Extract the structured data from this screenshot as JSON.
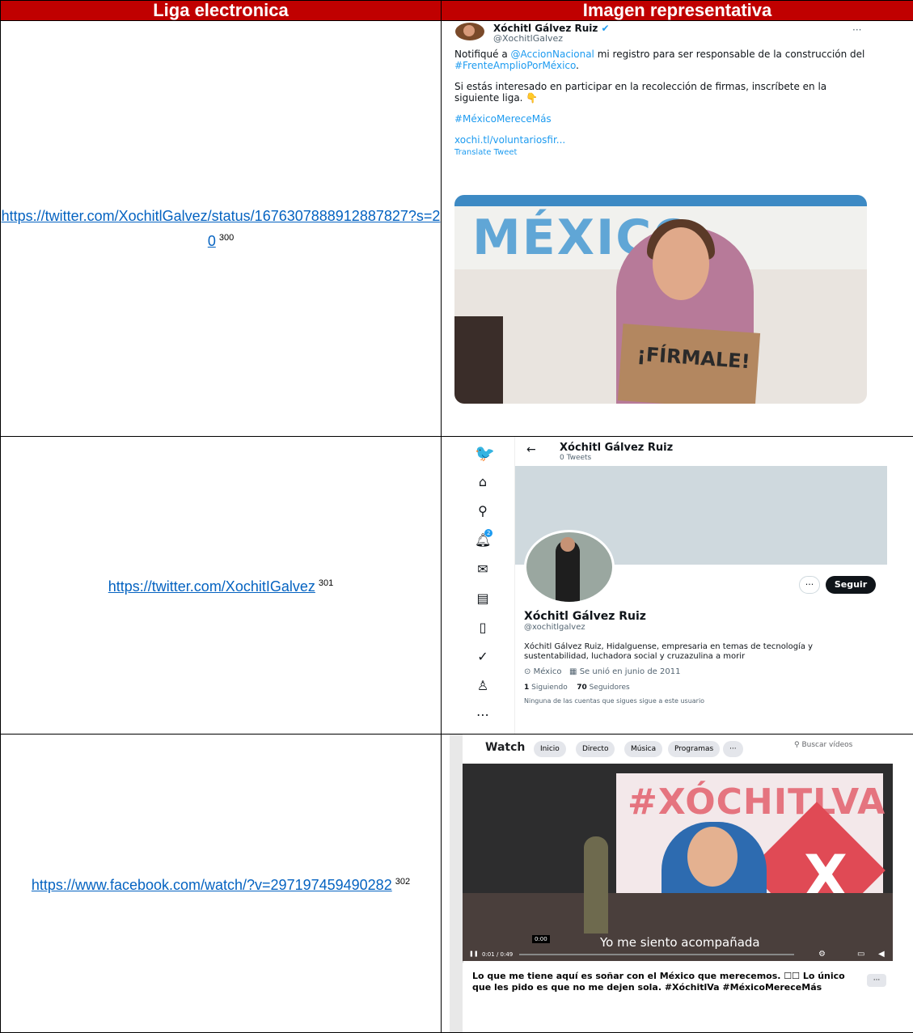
{
  "table": {
    "col1_header": "Liga electronica",
    "col2_header": "Imagen representativa"
  },
  "rows": [
    {
      "link": "https://twitter.com/XochitlGalvez/status/1676307888912887827?s=20",
      "note": "300"
    },
    {
      "link": "https://twitter.com/XochitIGalvez",
      "note": "301"
    },
    {
      "link": "https://www.facebook.com/watch/?v=297197459490282",
      "note": "302"
    }
  ],
  "tweet": {
    "name": "Xóchitl Gálvez Ruiz",
    "handle": "@XochitlGalvez",
    "more": "···",
    "p1_pre": "Notifiqué a ",
    "p1_mention": "@AccionNacional",
    "p1_mid": " mi registro para ser responsable de la construcción del ",
    "p1_tag": "#FrenteAmplioPorMéxico",
    "p1_end": ".",
    "p2": "Si estás interesado en participar en la recolección de firmas, inscríbete en la siguiente liga.",
    "p3": "#MéxicoMereceMás",
    "p4": "xochi.tl/voluntariosfir...",
    "translate": "Translate Tweet",
    "photo_banner": "MÉXICO",
    "photo_sign": "¡FÍRMALE!"
  },
  "profile": {
    "name": "Xóchitl Gálvez Ruiz",
    "tweets": "0 Tweets",
    "follow": "Seguir",
    "name2": "Xóchitl Gálvez Ruiz",
    "handle": "@xochitlgalvez",
    "bio": "Xóchitl Gálvez Ruiz, Hidalguense, empresaria en temas de tecnología y sustentabilidad, luchadora social y cruzazulina a morir",
    "location": "México",
    "joined": "Se unió en junio de 2011",
    "following_count": "1",
    "following_label": "Siguiendo",
    "followers_count": "70",
    "followers_label": "Seguidores",
    "note": "Ninguna de las cuentas que sigues sigue a este usuario",
    "notif_badge": "2"
  },
  "facebook": {
    "watch": "Watch",
    "chips": [
      "Inicio",
      "Directo",
      "Música",
      "Programas",
      "···"
    ],
    "search": "Buscar vídeos",
    "wall_tag": "#XÓCHITLVA",
    "caption": "Yo me siento acompañada",
    "time": "0:01 / 0:49",
    "time_marker": "0:00",
    "post": "Lo que me tiene aquí es soñar con el México que merecemos. ☐☐ Lo único que les pido es que no me dejen sola. #XóchitlVa #MéxicoMereceMás",
    "more": "···"
  }
}
